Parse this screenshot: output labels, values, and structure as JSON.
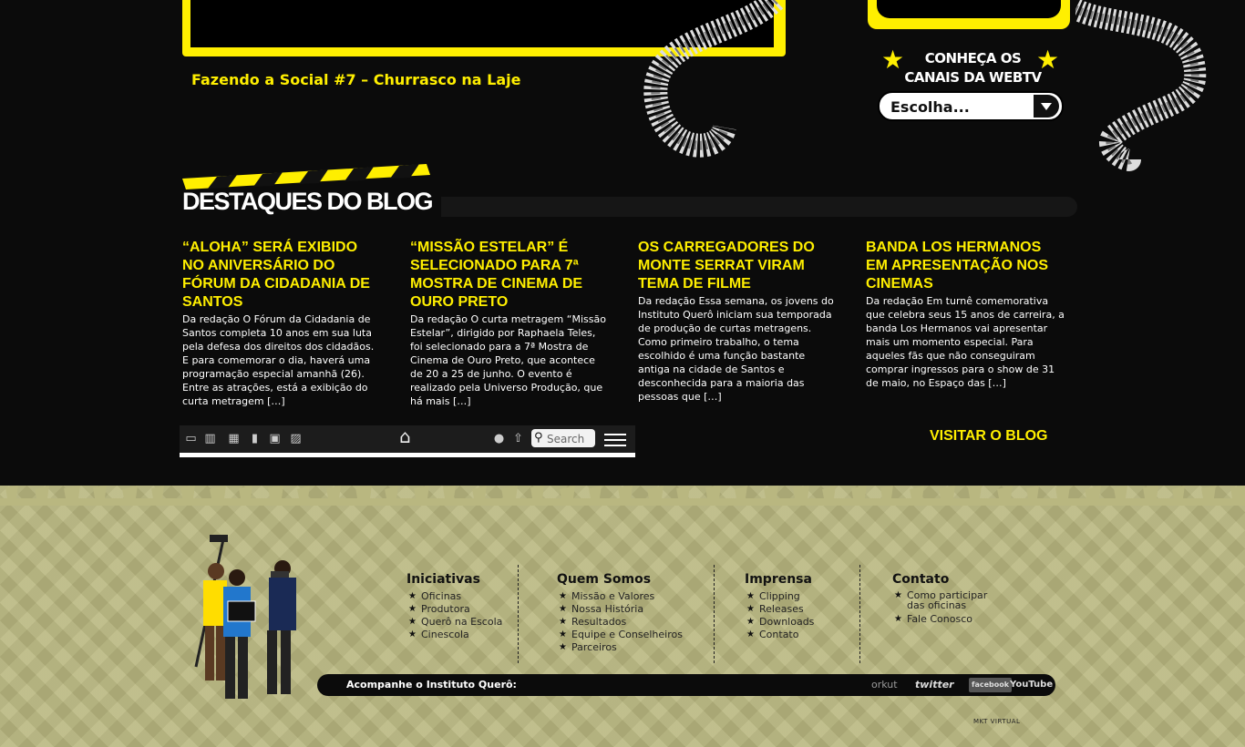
{
  "video": {
    "caption": "Fazendo a Social #7 – Churrasco na Laje"
  },
  "webtv": {
    "title_line1": "CONHEÇA OS",
    "title_line2": "CANAIS DA WEBTV",
    "select_value": "Escolha..."
  },
  "blog": {
    "heading": "DESTAQUES DO BLOG",
    "posts": [
      {
        "title": "“Aloha” será exibido no aniversário do Fórum da Cidadania de Santos",
        "excerpt": "Da redação O Fórum da Cidadania de Santos completa 10 anos em sua luta pela defesa dos direitos dos cidadãos. E para comemorar o dia, haverá uma programação especial amanhã (26). Entre as atrações, está a exibição do curta metragem […]"
      },
      {
        "title": "“Missão Estelar” é selecionado para 7ª Mostra de Cinema de Ouro Preto",
        "excerpt": "Da redação O curta metragem “Missão Estelar”, dirigido por Raphaela Teles, foi selecionado para a 7ª Mostra de Cinema de Ouro Preto, que acontece de 20 a 25 de junho. O evento é realizado pela Universo Produção, que há mais […]"
      },
      {
        "title": "Os carregadores do Monte Serrat viram tema de filme",
        "excerpt": "Da redação Essa semana, os jovens do Instituto Querô iniciam sua temporada de produção de curtas metragens. Como primeiro trabalho, o tema escolhido é uma função bastante antiga na cidade de Santos e desconhecida para a maioria das pessoas que […]"
      },
      {
        "title": "Banda Los Hermanos em apresentação nos cinemas",
        "excerpt": "Da redação Em turnê comemorativa que celebra seus 15 anos de carreira, a banda Los Hermanos vai apresentar mais um momento especial. Para aqueles fãs que não conseguiram comprar ingressos para o show de 31 de maio, no Espaço das […]"
      }
    ],
    "visit_label": "VISITAR O BLOG"
  },
  "toolbar": {
    "search_placeholder": "Search"
  },
  "footer": {
    "columns": [
      {
        "title": "Iniciativas",
        "items": [
          "Oficinas",
          "Produtora",
          "Querô na Escola",
          "Cinescola"
        ]
      },
      {
        "title": "Quem Somos",
        "items": [
          "Missão e Valores",
          "Nossa História",
          "Resultados",
          "Equipe e Conselheiros",
          "Parceiros"
        ]
      },
      {
        "title": "Imprensa",
        "items": [
          "Clipping",
          "Releases",
          "Downloads",
          "Contato"
        ]
      },
      {
        "title": "Contato",
        "items": [
          "Como participar das oficinas",
          "Fale Conosco"
        ]
      }
    ],
    "follow_label": "Acompanhe o Instituto Querô:",
    "social": [
      "orkut",
      "twitter",
      "facebook",
      "YouTube"
    ],
    "credit": "MKT VIRTUAL"
  },
  "colors": {
    "accent_yellow": "#ffef00",
    "background": "#0b0b0b",
    "footer_olive": "#b9b780"
  }
}
